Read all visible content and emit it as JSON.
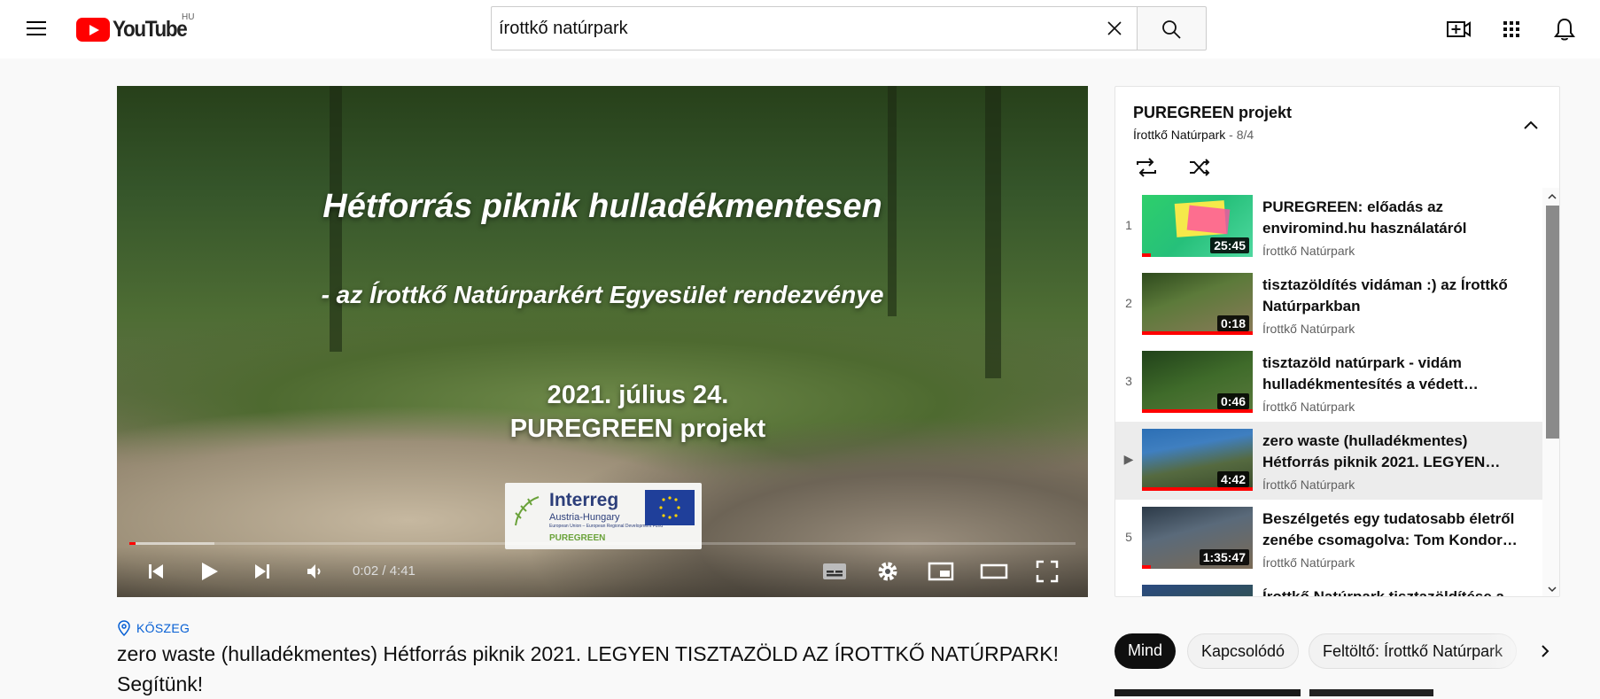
{
  "header": {
    "logo_text": "YouTube",
    "region": "HU",
    "search_value": "írottkő natúrpark",
    "icons": [
      "hamburger-icon",
      "search-icon",
      "clear-icon",
      "create-video-icon",
      "apps-icon",
      "notifications-icon"
    ]
  },
  "player": {
    "overlay_title": "Hétforrás piknik hulladékmentesen",
    "overlay_subtitle": "- az Írottkő Natúrparkért Egyesület rendezvénye",
    "overlay_date": "2021. július 24.",
    "overlay_project": "PUREGREEN projekt",
    "sponsor_name": "Interreg",
    "sponsor_region": "Austria-Hungary",
    "sponsor_fund": "European Union – European Regional Development Fund",
    "sponsor_project": "PUREGREEN",
    "time_display": "0:02 / 4:41",
    "progress_fraction": 0.007,
    "buffer_fraction": 0.09
  },
  "video_info": {
    "location": "KŐSZEG",
    "title": "zero waste (hulladékmentes) Hétforrás piknik 2021. LEGYEN TISZTAZÖLD AZ ÍROTTKŐ NATÚRPARK! Segítünk!"
  },
  "playlist": {
    "title": "PUREGREEN projekt",
    "channel": "Írottkő Natúrpark",
    "position": "- 8/4",
    "items": [
      {
        "index": "1",
        "title": "PUREGREEN: előadás az enviromind.hu használatáról",
        "channel": "Írottkő Natúrpark",
        "duration": "25:45",
        "active": false,
        "watched": "partial"
      },
      {
        "index": "2",
        "title": "tisztazöldítés vidáman :) az Írottkő Natúrparkban",
        "channel": "Írottkő Natúrpark",
        "duration": "0:18",
        "active": false,
        "watched": "full"
      },
      {
        "index": "3",
        "title": "tisztazöld natúrpark - vidám hulladékmentesítés a védett…",
        "channel": "Írottkő Natúrpark",
        "duration": "0:46",
        "active": false,
        "watched": "full"
      },
      {
        "index": "▶",
        "title": "zero waste (hulladékmentes) Hétforrás piknik 2021. LEGYEN…",
        "channel": "Írottkő Natúrpark",
        "duration": "4:42",
        "active": true,
        "watched": "full"
      },
      {
        "index": "5",
        "title": "Beszélgetés egy tudatosabb életről zenébe csomagolva: Tom Kondor…",
        "channel": "Írottkő Natúrpark",
        "duration": "1:35:47",
        "active": false,
        "watched": "partial"
      },
      {
        "index": "",
        "title": "Írottkő Natúrpark tisztazöldítése a…",
        "channel": "",
        "duration": "",
        "active": false,
        "watched": "none"
      }
    ]
  },
  "chips": [
    {
      "label": "Mind",
      "active": true
    },
    {
      "label": "Kapcsolódó",
      "active": false
    },
    {
      "label": "Feltöltő: Írottkő Natúrpark",
      "active": false
    }
  ],
  "colors": {
    "brand_red": "#ff0000",
    "link_blue": "#065fd4",
    "active_row": "#ececec"
  }
}
